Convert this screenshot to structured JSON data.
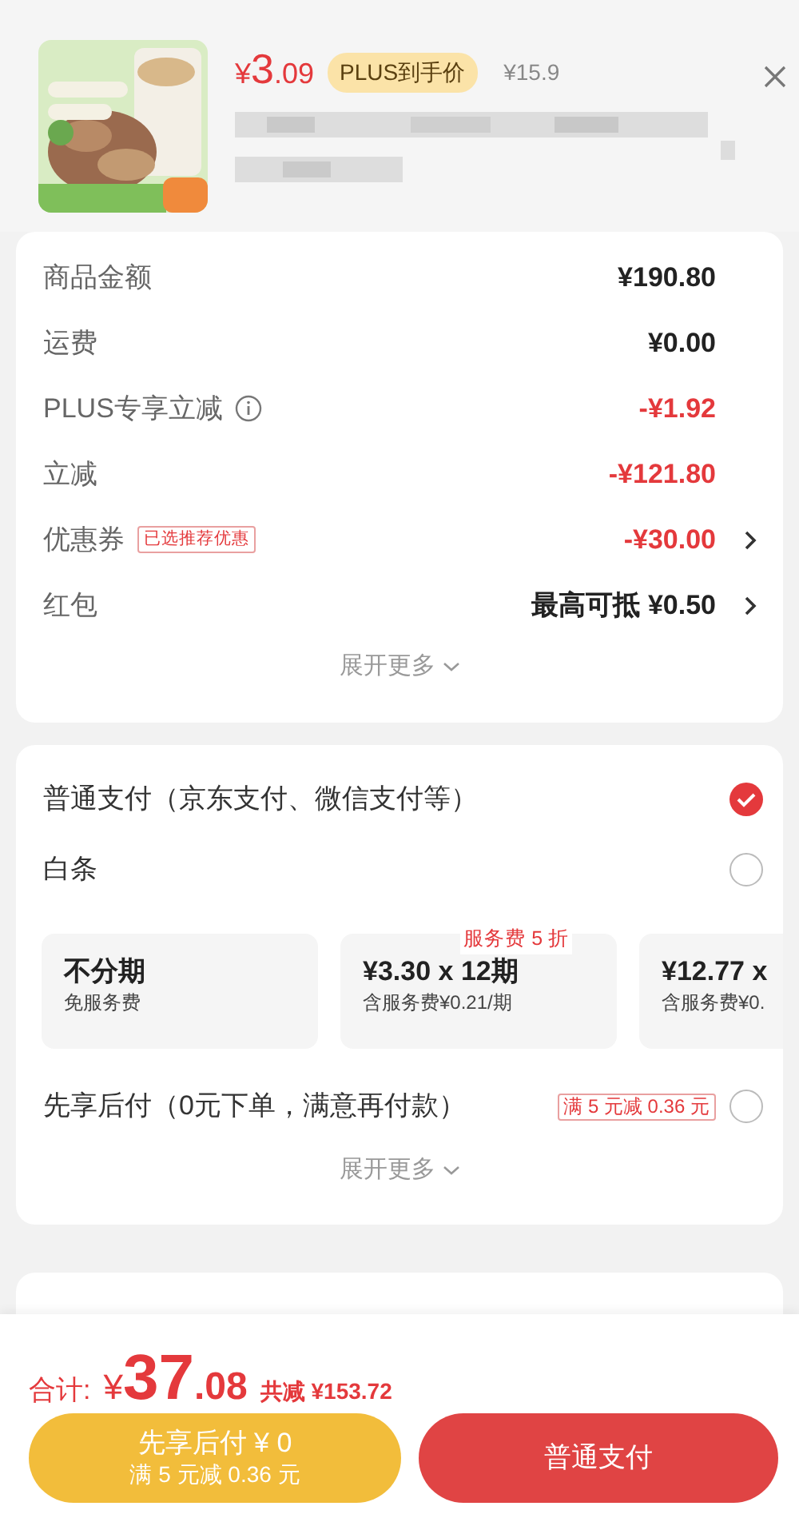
{
  "product": {
    "currency": "¥",
    "price_int": "3",
    "price_dec": ".09",
    "plus_badge": "PLUS到手价",
    "original_price": "¥15.9"
  },
  "summary": {
    "rows": [
      {
        "label": "商品金额",
        "value": "¥190.80",
        "kind": "plain",
        "arrow": false
      },
      {
        "label": "运费",
        "value": "¥0.00",
        "kind": "plain",
        "arrow": false
      },
      {
        "label": "PLUS专享立减",
        "value": "-¥1.92",
        "kind": "discount",
        "info": true,
        "arrow": false
      },
      {
        "label": "立减",
        "value": "-¥121.80",
        "kind": "discount",
        "arrow": false
      },
      {
        "label": "优惠券",
        "tag": "已选推荐优惠",
        "value": "-¥30.00",
        "kind": "discount",
        "arrow": true
      },
      {
        "label": "红包",
        "value": "最高可抵 ¥0.50",
        "kind": "plain",
        "arrow": true
      }
    ],
    "expand": "展开更多"
  },
  "payment": {
    "methods": [
      {
        "label": "普通支付（京东支付、微信支付等）",
        "selected": true
      },
      {
        "label": "白条",
        "selected": false,
        "plans": [
          {
            "title": "不分期",
            "sub": "免服务费"
          },
          {
            "title": "¥3.30 x 12期",
            "sub": "含服务费¥0.21/期",
            "badge": "服务费 5 折"
          },
          {
            "title": "¥12.77 x",
            "sub": "含服务费¥0."
          }
        ]
      },
      {
        "label": "先享后付（0元下单，满意再付款）",
        "promo": "满 5 元减 0.36 元",
        "selected": false
      }
    ],
    "expand": "展开更多"
  },
  "footer": {
    "total_label": "合计:",
    "currency": "¥",
    "total_int": "37",
    "total_dec": ".08",
    "saved": "共减 ¥153.72",
    "buttons": [
      {
        "kind": "later",
        "line1": "先享后付 ¥ 0",
        "line2": "满 5 元减 0.36 元"
      },
      {
        "kind": "pay",
        "line1": "普通支付"
      }
    ]
  }
}
